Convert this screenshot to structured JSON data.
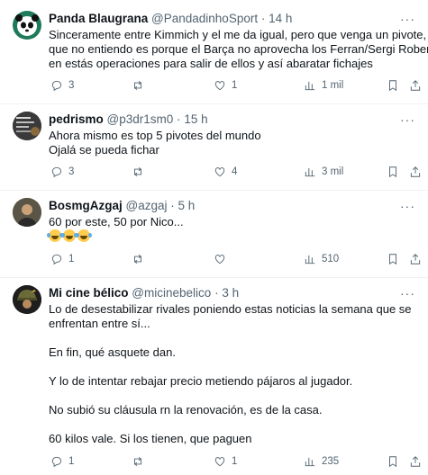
{
  "tweets": [
    {
      "name": "Panda Blaugrana",
      "handle": "@PandadinhoSport",
      "sep": "·",
      "time": "14 h",
      "lines": [
        "Sinceramente entre Kimmich y el me da igual, pero que venga un pivote, lo",
        "que no entiendo es porque el Barça no aprovecha los Ferran/Sergi Roberto",
        "en estás operaciones para salir de ellos y así abaratar fichajes"
      ],
      "replies": "3",
      "retweets": "",
      "likes": "1",
      "views": "1 mil"
    },
    {
      "name": "pedrismo",
      "handle": "@p3dr1sm0",
      "sep": "·",
      "time": "15 h",
      "lines": [
        "Ahora mismo es top 5 pivotes del mundo",
        "Ojalá se pueda fichar"
      ],
      "replies": "3",
      "retweets": "",
      "likes": "4",
      "views": "3 mil"
    },
    {
      "name": "BosmgAzgaj",
      "handle": "@azgaj",
      "sep": "·",
      "time": "5 h",
      "lines": [
        "60 por este, 50 por Nico..."
      ],
      "emoji_line": "🤣🤣🤣",
      "replies": "1",
      "retweets": "",
      "likes": "",
      "views": "510"
    },
    {
      "name": "Mi cine bélico",
      "handle": "@micinebelico",
      "sep": "·",
      "time": "3 h",
      "lines": [
        "Lo de desestabilizar rivales poniendo estas noticias la semana que se",
        "enfrentan entre sí...",
        "",
        "En fin, qué asquete dan.",
        "",
        "Y lo de intentar rebajar precio metiendo pájaros al jugador.",
        "",
        "No subió su cláusula rn la renovación, es de la casa.",
        "",
        "60 kilos vale. Si los tienen, que paguen"
      ],
      "replies": "1",
      "retweets": "",
      "likes": "1",
      "views": "235"
    }
  ],
  "more_label": "···",
  "icons": [
    "reply-icon",
    "retweet-icon",
    "like-icon",
    "views-icon",
    "bookmark-icon",
    "share-icon"
  ],
  "colors": {
    "text": "#0f1419",
    "muted": "#536471",
    "border": "#eff3f4"
  }
}
